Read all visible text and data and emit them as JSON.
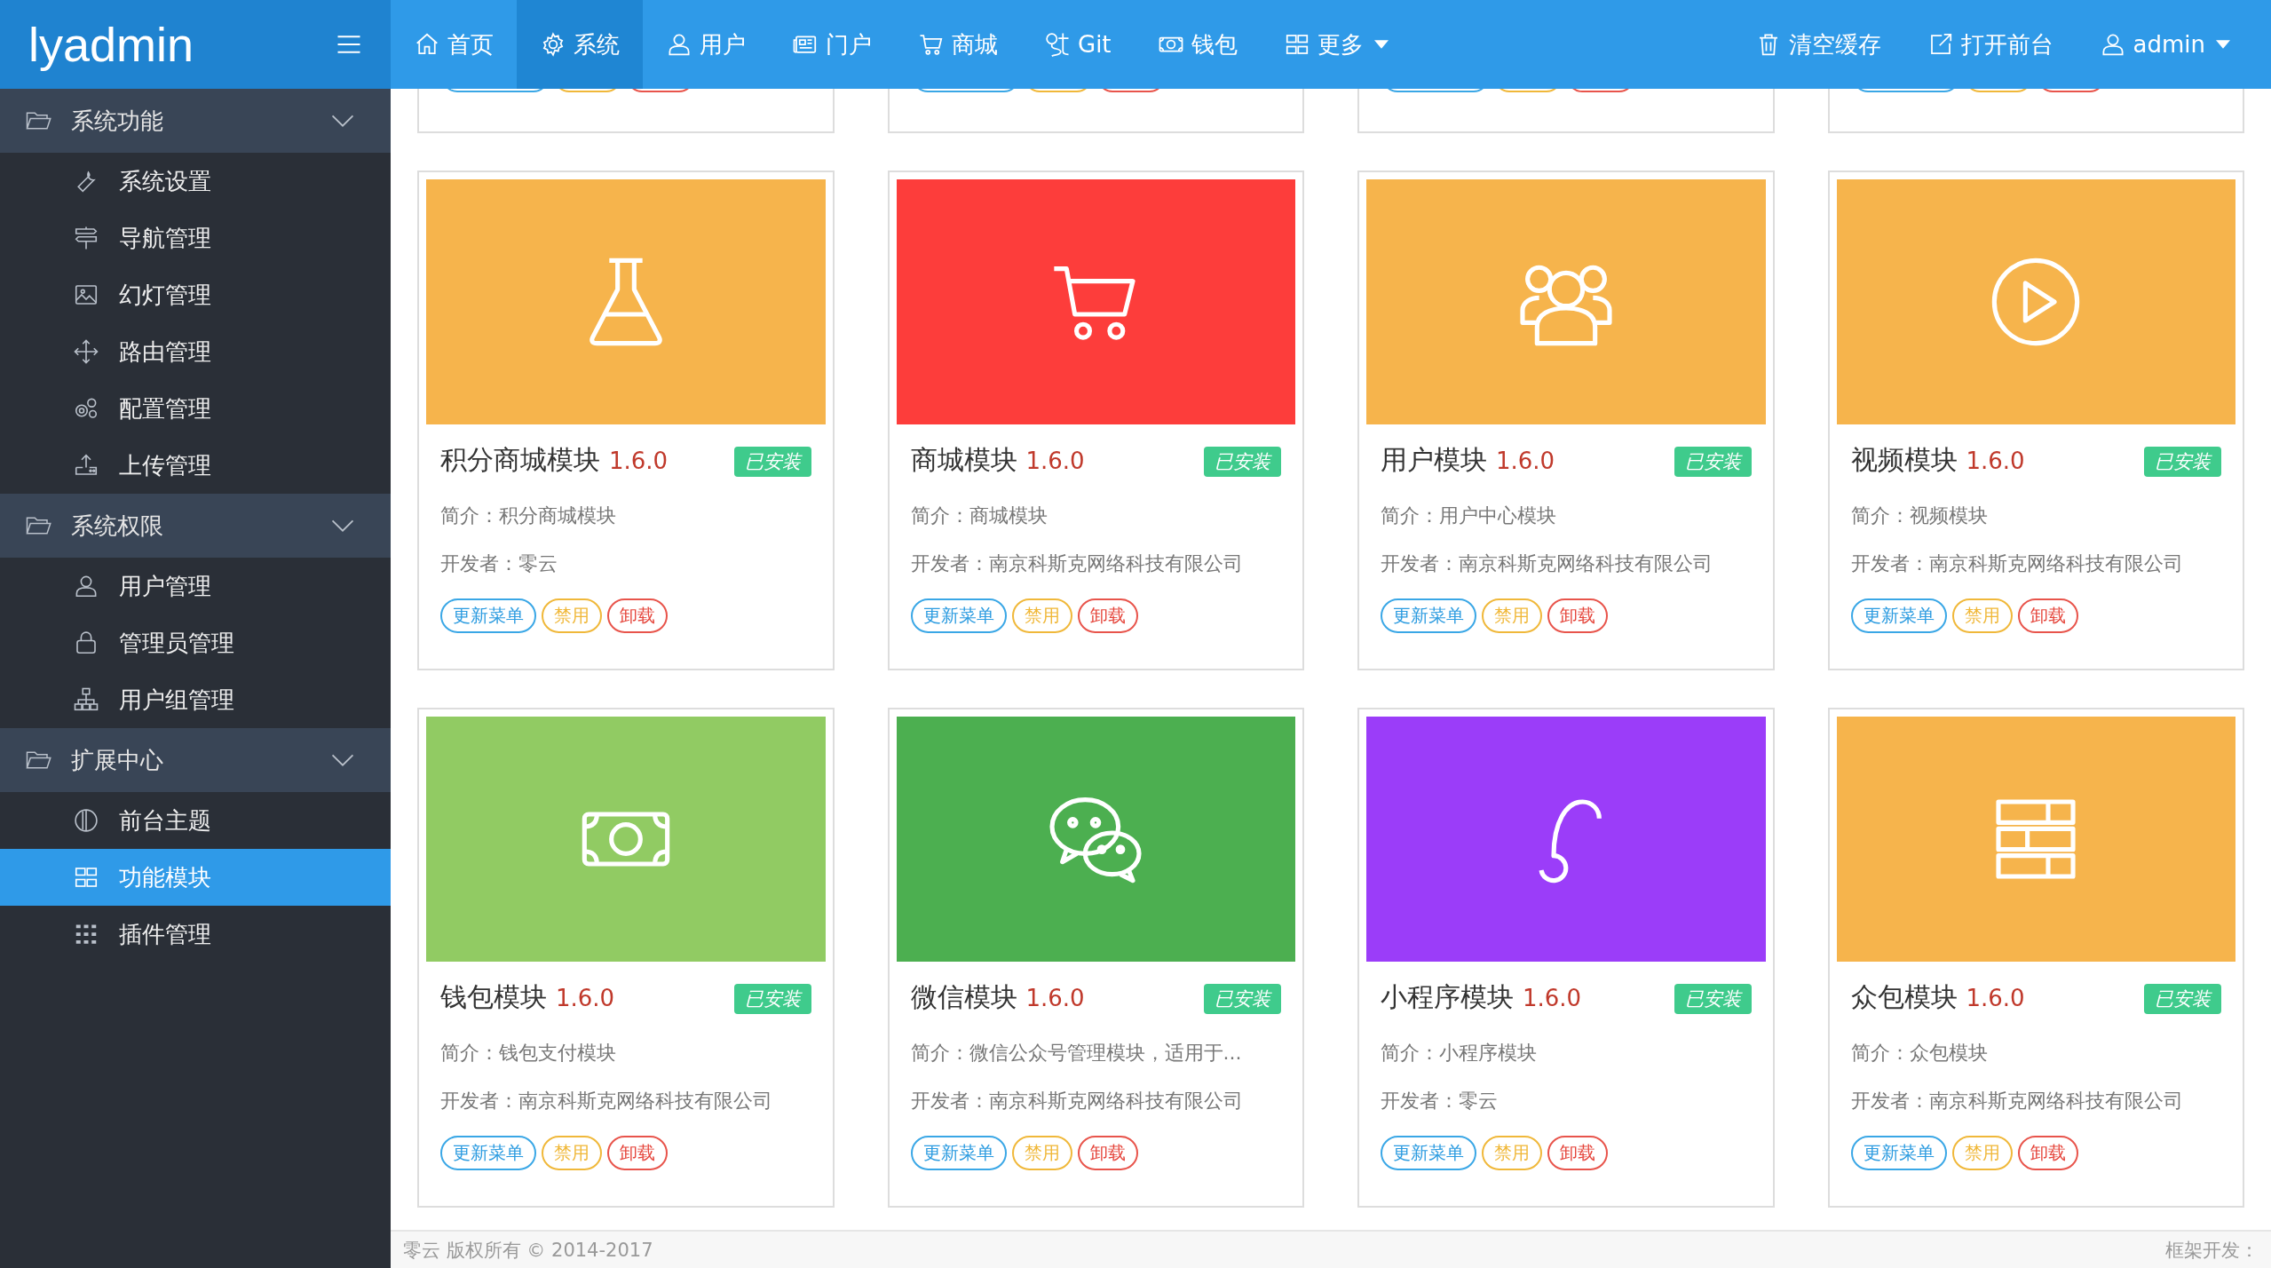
{
  "brand": {
    "title": "lyadmin"
  },
  "topnav": {
    "items": [
      {
        "label": "首页",
        "selected": false,
        "dropdown": false
      },
      {
        "label": "系统",
        "selected": true,
        "dropdown": false
      },
      {
        "label": "用户",
        "selected": false,
        "dropdown": false
      },
      {
        "label": "门户",
        "selected": false,
        "dropdown": false
      },
      {
        "label": "商城",
        "selected": false,
        "dropdown": false
      },
      {
        "label": "Git",
        "selected": false,
        "dropdown": false
      },
      {
        "label": "钱包",
        "selected": false,
        "dropdown": false
      },
      {
        "label": "更多",
        "selected": false,
        "dropdown": true
      }
    ],
    "right": [
      {
        "label": "清空缓存",
        "dropdown": false
      },
      {
        "label": "打开前台",
        "dropdown": false
      },
      {
        "label": "admin",
        "dropdown": true
      }
    ]
  },
  "sidebar": {
    "groups": [
      {
        "label": "系统功能",
        "expanded": true,
        "children": [
          {
            "label": "系统设置",
            "selected": false
          },
          {
            "label": "导航管理",
            "selected": false
          },
          {
            "label": "幻灯管理",
            "selected": false
          },
          {
            "label": "路由管理",
            "selected": false
          },
          {
            "label": "配置管理",
            "selected": false
          },
          {
            "label": "上传管理",
            "selected": false
          }
        ]
      },
      {
        "label": "系统权限",
        "expanded": true,
        "children": [
          {
            "label": "用户管理",
            "selected": false
          },
          {
            "label": "管理员管理",
            "selected": false
          },
          {
            "label": "用户组管理",
            "selected": false
          }
        ]
      },
      {
        "label": "扩展中心",
        "expanded": true,
        "children": [
          {
            "label": "前台主题",
            "selected": false
          },
          {
            "label": "功能模块",
            "selected": true
          },
          {
            "label": "插件管理",
            "selected": false
          }
        ]
      }
    ]
  },
  "modules": [
    {
      "title": "积分商城模块",
      "version": "1.6.0",
      "status": "已安装",
      "color": "#f6b44c",
      "intro": "简介：积分商城模块",
      "developer": "开发者：零云",
      "actions": [
        {
          "label": "更新菜单",
          "kind": "update"
        },
        {
          "label": "禁用",
          "kind": "disable"
        },
        {
          "label": "卸载",
          "kind": "uninstall"
        }
      ]
    },
    {
      "title": "商城模块",
      "version": "1.6.0",
      "status": "已安装",
      "color": "#fd3d3b",
      "intro": "简介：商城模块",
      "developer": "开发者：南京科斯克网络科技有限公司",
      "actions": [
        {
          "label": "更新菜单",
          "kind": "update"
        },
        {
          "label": "禁用",
          "kind": "disable"
        },
        {
          "label": "卸载",
          "kind": "uninstall"
        }
      ]
    },
    {
      "title": "用户模块",
      "version": "1.6.0",
      "status": "已安装",
      "color": "#f6b44c",
      "intro": "简介：用户中心模块",
      "developer": "开发者：南京科斯克网络科技有限公司",
      "actions": [
        {
          "label": "更新菜单",
          "kind": "update"
        },
        {
          "label": "禁用",
          "kind": "disable"
        },
        {
          "label": "卸载",
          "kind": "uninstall"
        }
      ]
    },
    {
      "title": "视频模块",
      "version": "1.6.0",
      "status": "已安装",
      "color": "#f6b44c",
      "intro": "简介：视频模块",
      "developer": "开发者：南京科斯克网络科技有限公司",
      "actions": [
        {
          "label": "更新菜单",
          "kind": "update"
        },
        {
          "label": "禁用",
          "kind": "disable"
        },
        {
          "label": "卸载",
          "kind": "uninstall"
        }
      ]
    },
    {
      "title": "钱包模块",
      "version": "1.6.0",
      "status": "已安装",
      "color": "#91cb63",
      "intro": "简介：钱包支付模块",
      "developer": "开发者：南京科斯克网络科技有限公司",
      "actions": [
        {
          "label": "更新菜单",
          "kind": "update"
        },
        {
          "label": "禁用",
          "kind": "disable"
        },
        {
          "label": "卸载",
          "kind": "uninstall"
        }
      ]
    },
    {
      "title": "微信模块",
      "version": "1.6.0",
      "status": "已安装",
      "color": "#4caf50",
      "intro": "简介：微信公众号管理模块，适用于...",
      "developer": "开发者：南京科斯克网络科技有限公司",
      "actions": [
        {
          "label": "更新菜单",
          "kind": "update"
        },
        {
          "label": "禁用",
          "kind": "disable"
        },
        {
          "label": "卸载",
          "kind": "uninstall"
        }
      ]
    },
    {
      "title": "小程序模块",
      "version": "1.6.0",
      "status": "已安装",
      "color": "#9b3df9",
      "intro": "简介：小程序模块",
      "developer": "开发者：零云",
      "actions": [
        {
          "label": "更新菜单",
          "kind": "update"
        },
        {
          "label": "禁用",
          "kind": "disable"
        },
        {
          "label": "卸载",
          "kind": "uninstall"
        }
      ]
    },
    {
      "title": "众包模块",
      "version": "1.6.0",
      "status": "已安装",
      "color": "#f6b44c",
      "intro": "简介：众包模块",
      "developer": "开发者：南京科斯克网络科技有限公司",
      "actions": [
        {
          "label": "更新菜单",
          "kind": "update"
        },
        {
          "label": "禁用",
          "kind": "disable"
        },
        {
          "label": "卸载",
          "kind": "uninstall"
        }
      ]
    }
  ],
  "footer": {
    "copyright": "零云 版权所有 © 2014-2017",
    "credit": "框架开发："
  }
}
